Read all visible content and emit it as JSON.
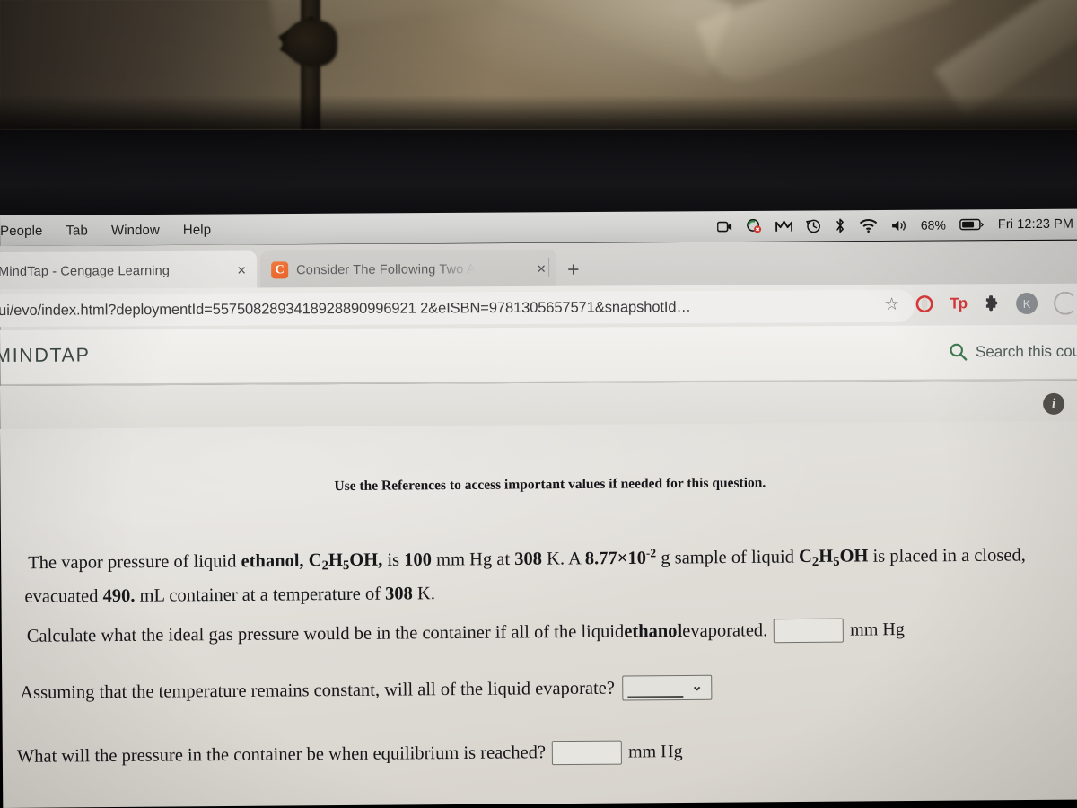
{
  "menubar": {
    "items": [
      "People",
      "Tab",
      "Window",
      "Help"
    ],
    "status_icons": [
      "screen-recording-icon",
      "dropbox-icon",
      "malwarebytes-icon",
      "time-machine-icon",
      "bluetooth-icon",
      "wifi-icon",
      "volume-icon"
    ],
    "battery_percent": "68%",
    "clock": "Fri 12:23 PM"
  },
  "browser": {
    "tabs": [
      {
        "title": "MindTap - Cengage Learning",
        "favicon": "none",
        "close": "×",
        "active": false
      },
      {
        "title": "Consider The Following Two A",
        "favicon": "chegg-icon",
        "favicon_letter": "C",
        "close": "×",
        "active": true
      }
    ],
    "new_tab": "+",
    "url": "ui/evo/index.html?deploymentId=5575082893418928890996921  2&eISBN=9781305657571&snapshotId…",
    "bookmark_icon": "☆",
    "extensions": [
      "opera-icon",
      "tp-icon",
      "puzzle-extensions-icon"
    ],
    "extension_tp_label": "Tp",
    "avatar_letter": "K"
  },
  "mindtap": {
    "logo": "MINDTAP",
    "search_placeholder": "Search this cou",
    "search_icon": "search-icon",
    "info_icon": "i"
  },
  "question": {
    "reference_note": "Use the References to access important values if needed for this question.",
    "body_line1_part1": "The vapor pressure of liquid ",
    "body_ethanol": "ethanol,",
    "body_formula1": "C2H5OH,",
    "body_line1_part2": " is ",
    "body_pressure": "100",
    "body_line1_part3": " mm Hg at ",
    "body_temp1": "308",
    "body_line1_part4": " K. A ",
    "body_mass": "8.77×10",
    "body_mass_exp": "-2",
    "body_line1_part5": " g sample of liquid ",
    "body_formula2": "C2H5OH",
    "body_line1_part6": " is placed in a closed,",
    "body_line2_part1": "evacuated ",
    "body_volume": "490.",
    "body_line2_part2": " mL container at a temperature of ",
    "body_temp2": "308",
    "body_line2_part3": " K.",
    "q1_part1": "Calculate what the ideal gas pressure would be in the container if all of the liquid ",
    "q1_bold": "ethanol",
    "q1_part2": " evaporated.",
    "q1_answer": "",
    "q1_unit": "mm Hg",
    "q2_text": "Assuming that the temperature remains constant, will all of the liquid evaporate?",
    "q2_selected": "",
    "q2_caret": "⌄",
    "q3_text": "What will the pressure in the container be when equilibrium is reached?",
    "q3_answer": "",
    "q3_unit": "mm Hg"
  }
}
